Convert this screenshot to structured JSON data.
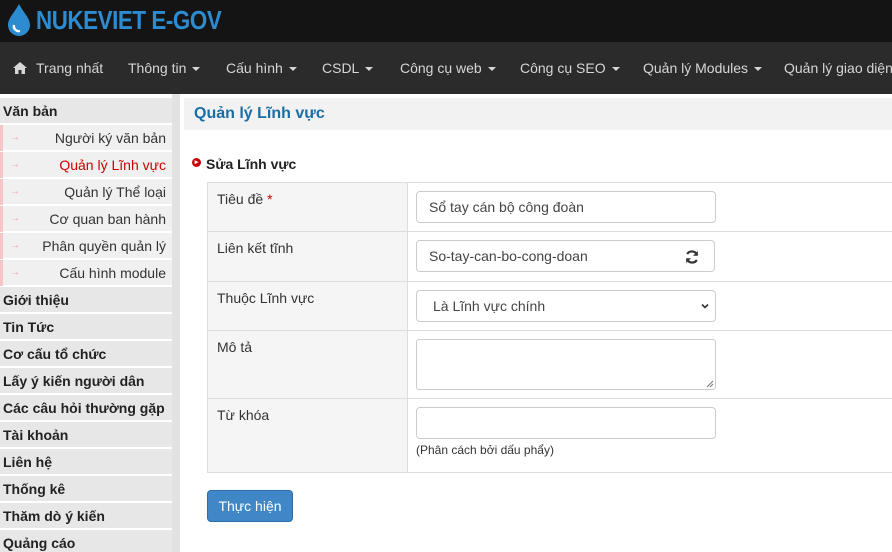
{
  "brand": {
    "logo_text": "NUKEVIET E-GOV",
    "accent_color": "#2d8bd0"
  },
  "nav": {
    "home_label": "Trang nhất",
    "items": [
      "Thông tin",
      "Cấu hình",
      "CSDL",
      "Công cụ web",
      "Công cụ SEO",
      "Quản lý Modules",
      "Quản lý giao diện"
    ]
  },
  "sidebar": {
    "section_active": "Văn bản",
    "sub_items": [
      "Người ký văn bản",
      "Quản lý Lĩnh vực",
      "Quản lý Thể loại",
      "Cơ quan ban hành",
      "Phân quyền quản lý",
      "Cấu hình module"
    ],
    "active_sub": "Quản lý Lĩnh vực",
    "sections": [
      "Giới thiệu",
      "Tin Tức",
      "Cơ cấu tổ chức",
      "Lấy ý kiến người dân",
      "Các câu hỏi thường gặp",
      "Tài khoản",
      "Liên hệ",
      "Thống kê",
      "Thăm dò ý kiến",
      "Quảng cáo"
    ]
  },
  "page": {
    "title": "Quản lý Lĩnh vực"
  },
  "form": {
    "title": "Sửa Lĩnh vực",
    "required_mark": "*",
    "fields": {
      "title": {
        "label": "Tiêu đề",
        "value": "Sổ tay cán bộ công đoàn"
      },
      "alias": {
        "label": "Liên kết tĩnh",
        "value": "So-tay-can-bo-cong-doan"
      },
      "parent": {
        "label": "Thuộc Lĩnh vực",
        "value": "Là Lĩnh vực chính"
      },
      "description": {
        "label": "Mô tả",
        "value": ""
      },
      "keywords": {
        "label": "Từ khóa",
        "value": "",
        "hint": "(Phân cách bởi dấu phẩy)"
      }
    },
    "submit_label": "Thực hiện"
  },
  "colors": {
    "active_red": "#cc0000",
    "button_blue": "#3f87c6",
    "title_blue": "#1a6ea6"
  }
}
